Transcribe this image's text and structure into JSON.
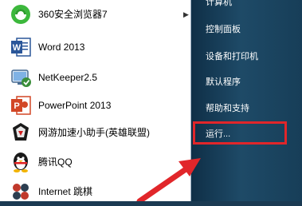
{
  "start_menu": {
    "programs": [
      {
        "label": "360安全浏览器7",
        "icon": "360-browser-icon"
      },
      {
        "label": "Word 2013",
        "icon": "word-icon"
      },
      {
        "label": "NetKeeper2.5",
        "icon": "netkeeper-icon"
      },
      {
        "label": "PowerPoint 2013",
        "icon": "powerpoint-icon"
      },
      {
        "label": "网游加速小助手(英雄联盟)",
        "icon": "game-accelerator-icon"
      },
      {
        "label": "腾讯QQ",
        "icon": "qq-penguin-icon"
      },
      {
        "label": "Internet 跳棋",
        "icon": "internet-checkers-icon"
      }
    ],
    "right_pane": [
      {
        "label": "计算机"
      },
      {
        "label": "控制面板"
      },
      {
        "label": "设备和打印机"
      },
      {
        "label": "默认程序"
      },
      {
        "label": "帮助和支持"
      },
      {
        "label": "运行..."
      }
    ]
  },
  "annotation": {
    "highlight_color": "#e1262a"
  }
}
